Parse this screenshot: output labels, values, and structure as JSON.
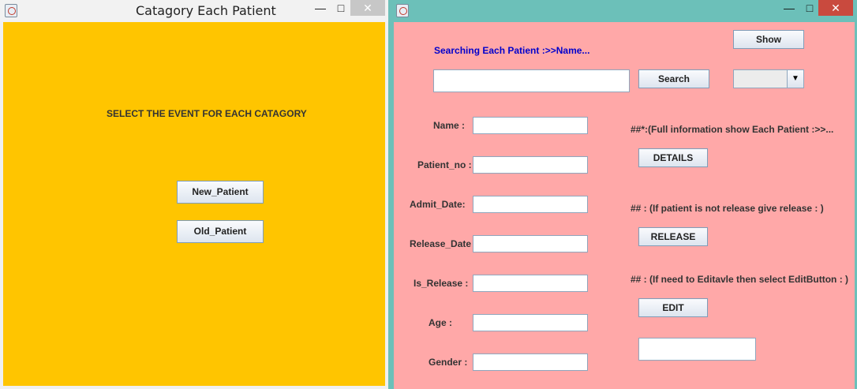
{
  "left_window": {
    "title": "Catagory Each Patient",
    "controls": {
      "minimize": "—",
      "maximize": "□",
      "close": "✕"
    },
    "heading": "SELECT THE EVENT FOR EACH CATAGORY",
    "buttons": {
      "new_patient": "New_Patient",
      "old_patient": "Old_Patient"
    },
    "bg_color": "#ffc500"
  },
  "right_window": {
    "controls": {
      "minimize": "—",
      "maximize": "□",
      "close": "✕"
    },
    "search_prompt": "Searching Each Patient :>>Name...",
    "show_label": "Show",
    "search_value": "",
    "search_button": "Search",
    "dropdown_value": "",
    "form": {
      "name_label": "Name :",
      "patient_no_label": "Patient_no :",
      "admit_date_label": "Admit_Date:",
      "release_date_label": "Release_Date",
      "is_release_label": "Is_Release :",
      "age_label": "Age :",
      "gender_label": "Gender :",
      "values": {
        "name": "",
        "patient_no": "",
        "admit_date": "",
        "release_date": "",
        "is_release": "",
        "age": "",
        "gender": ""
      }
    },
    "details_note": "##*:(Full information show Each Patient :>>...",
    "details_button": "DETAILS",
    "release_note": "## : (If patient is not release give release : )",
    "release_button": "RELEASE",
    "edit_note": "## : (If need to Editavle then select EditButton   : )",
    "edit_button": "EDIT",
    "extra_value": "",
    "bg_color": "#ffa8a8",
    "accent_color": "#0000cc"
  }
}
